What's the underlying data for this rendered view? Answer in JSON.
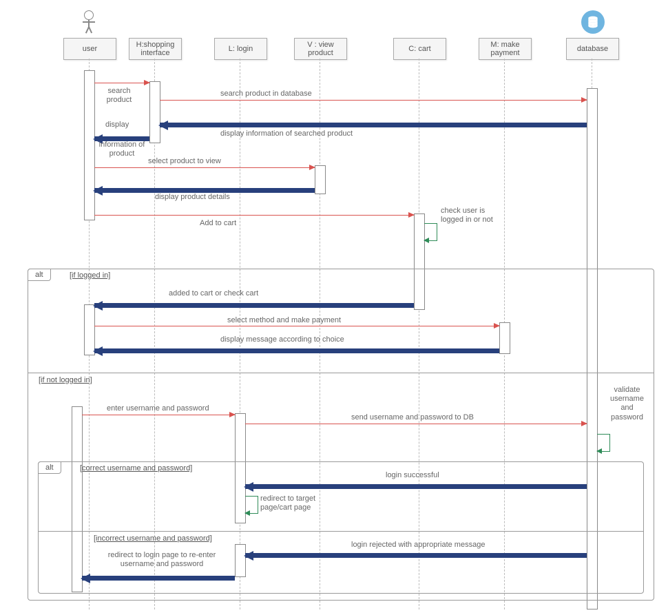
{
  "participants": {
    "user": "user",
    "shopping": "H:shopping interface",
    "login": "L: login",
    "view": "V : view product",
    "cart": "C: cart",
    "payment": "M: make payment",
    "database": "database"
  },
  "frames": {
    "alt1_tag": "alt",
    "alt1_guard": "[if logged  in]",
    "alt1_guard2": "[if not logged in]",
    "alt2_tag": "alt",
    "alt2_guard": "[correct username and password]",
    "alt2_guard2": "[incorrect username and password]"
  },
  "messages": {
    "m1": "search product",
    "m2": "search product in database",
    "m3a": "display",
    "m3b": "information of product",
    "m4": "display information of searched product",
    "m5": "select product to view",
    "m6": "display product details",
    "m7": "Add to cart",
    "m8": "check user is logged in or not",
    "m9": "added to cart or check cart",
    "m10": "select method and make payment",
    "m11": "display message according to choice",
    "m12": "enter username and password",
    "m13": "send username and password to DB",
    "m14": "validate username and password",
    "m15": "login successful",
    "m16": "redirect to target page/cart page",
    "m17": "login rejected with appropriate message",
    "m18": "redirect to login page to re-enter username and password"
  }
}
